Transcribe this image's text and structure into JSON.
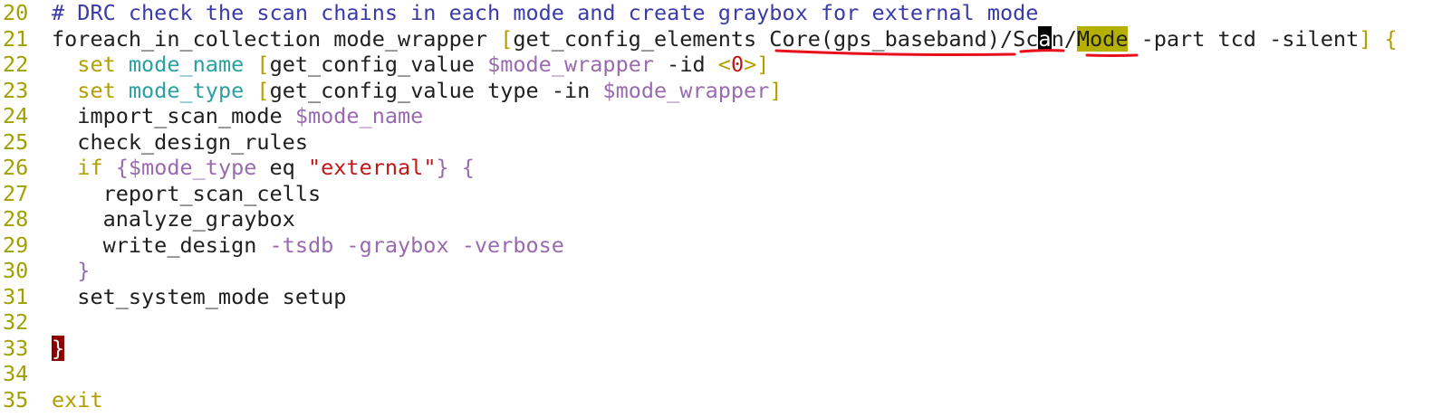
{
  "editor": {
    "lines": [
      {
        "num": "20",
        "tokens": [
          {
            "t": "# DRC check the scan chains in each mode and create graybox for external mode",
            "c": "comment"
          }
        ]
      },
      {
        "num": "21",
        "tokens": [
          {
            "t": "foreach_in_collection mode_wrapper ",
            "c": "plain"
          },
          {
            "t": "[",
            "c": "bracket"
          },
          {
            "t": "get_config_elements Core(gps_baseband)/Sc",
            "c": "plain"
          },
          {
            "t": "a",
            "c": "cursor"
          },
          {
            "t": "n/",
            "c": "plain"
          },
          {
            "t": "Mode",
            "c": "hl-mode"
          },
          {
            "t": " -part tcd -silent",
            "c": "plain"
          },
          {
            "t": "] {",
            "c": "bracket"
          }
        ]
      },
      {
        "num": "22",
        "tokens": [
          {
            "t": "  ",
            "c": "plain"
          },
          {
            "t": "set",
            "c": "kw"
          },
          {
            "t": " ",
            "c": "plain"
          },
          {
            "t": "mode_name",
            "c": "var"
          },
          {
            "t": " ",
            "c": "plain"
          },
          {
            "t": "[",
            "c": "bracket"
          },
          {
            "t": "get_config_value ",
            "c": "plain"
          },
          {
            "t": "$mode_wrapper",
            "c": "param"
          },
          {
            "t": " -id ",
            "c": "plain"
          },
          {
            "t": "<",
            "c": "angle"
          },
          {
            "t": "0",
            "c": "num"
          },
          {
            "t": ">",
            "c": "angle"
          },
          {
            "t": "]",
            "c": "bracket"
          }
        ]
      },
      {
        "num": "23",
        "tokens": [
          {
            "t": "  ",
            "c": "plain"
          },
          {
            "t": "set",
            "c": "kw"
          },
          {
            "t": " ",
            "c": "plain"
          },
          {
            "t": "mode_type",
            "c": "var"
          },
          {
            "t": " ",
            "c": "plain"
          },
          {
            "t": "[",
            "c": "bracket"
          },
          {
            "t": "get_config_value type -in ",
            "c": "plain"
          },
          {
            "t": "$mode_wrapper",
            "c": "param"
          },
          {
            "t": "]",
            "c": "bracket"
          }
        ]
      },
      {
        "num": "24",
        "tokens": [
          {
            "t": "  import_scan_mode ",
            "c": "plain"
          },
          {
            "t": "$mode_name",
            "c": "param"
          }
        ]
      },
      {
        "num": "25",
        "tokens": [
          {
            "t": "  check_design_rules",
            "c": "plain"
          }
        ]
      },
      {
        "num": "26",
        "tokens": [
          {
            "t": "  ",
            "c": "plain"
          },
          {
            "t": "if",
            "c": "kw"
          },
          {
            "t": " ",
            "c": "plain"
          },
          {
            "t": "{",
            "c": "brace"
          },
          {
            "t": "$mode_type",
            "c": "param"
          },
          {
            "t": " eq ",
            "c": "plain"
          },
          {
            "t": "\"external\"",
            "c": "str"
          },
          {
            "t": "} {",
            "c": "brace"
          }
        ]
      },
      {
        "num": "27",
        "tokens": [
          {
            "t": "    report_scan_cells",
            "c": "plain"
          }
        ]
      },
      {
        "num": "28",
        "tokens": [
          {
            "t": "    analyze_graybox",
            "c": "plain"
          }
        ]
      },
      {
        "num": "29",
        "tokens": [
          {
            "t": "    write_design ",
            "c": "plain"
          },
          {
            "t": "-tsdb -graybox -verbose",
            "c": "param"
          }
        ]
      },
      {
        "num": "30",
        "tokens": [
          {
            "t": "  ",
            "c": "plain"
          },
          {
            "t": "}",
            "c": "brace"
          }
        ]
      },
      {
        "num": "31",
        "tokens": [
          {
            "t": "  set_system_mode setup",
            "c": "plain"
          }
        ]
      },
      {
        "num": "32",
        "tokens": []
      },
      {
        "num": "33",
        "tokens": [
          {
            "t": "}",
            "c": "bracematch"
          }
        ]
      },
      {
        "num": "34",
        "tokens": []
      },
      {
        "num": "35",
        "tokens": [
          {
            "t": "exit",
            "c": "kw"
          }
        ]
      }
    ]
  },
  "colors": {
    "line_number": "#a0a000",
    "comment": "#3a3aa8",
    "keyword": "#b0a000",
    "variable": "#2aa0a0",
    "parameter": "#9a6ab0",
    "string": "#c01818",
    "mode_highlight": "#b5b000",
    "annotation_underline": "#e8101a"
  }
}
